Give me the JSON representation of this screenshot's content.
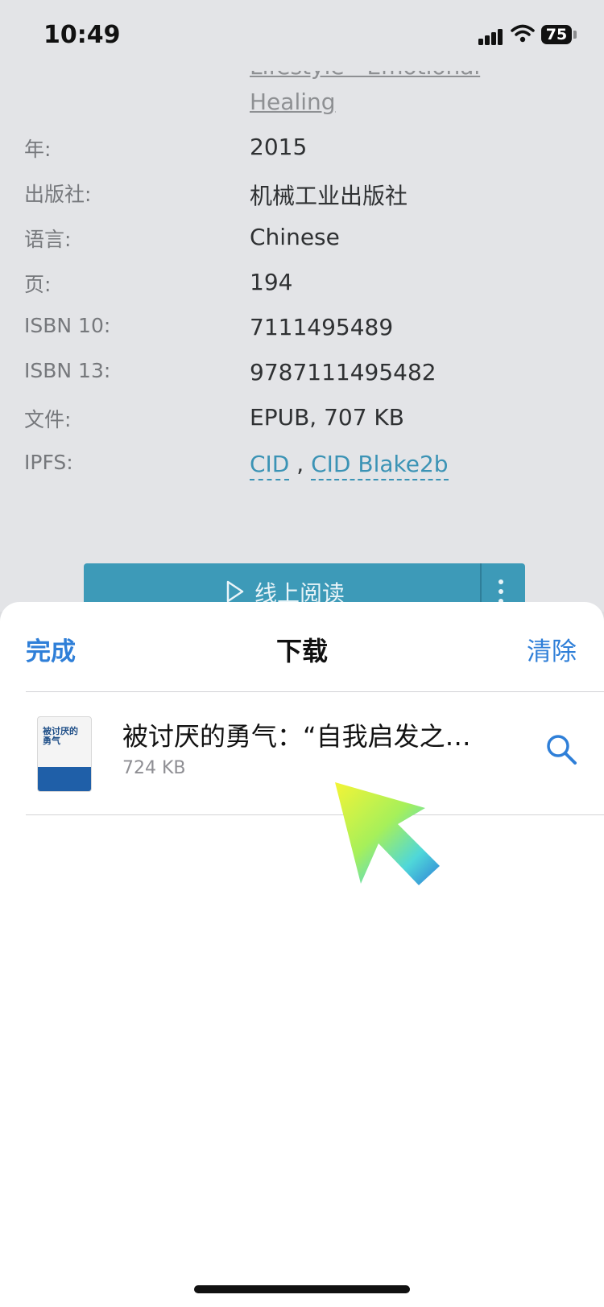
{
  "status_bar": {
    "time": "10:49",
    "battery": "75"
  },
  "details": {
    "category_partial_line1": "Lifestyle - Emotional",
    "category_partial_line2": "Healing",
    "rows": [
      {
        "label": "年:",
        "value": "2015"
      },
      {
        "label": "出版社:",
        "value": "机械工业出版社"
      },
      {
        "label": "语言:",
        "value": "Chinese"
      },
      {
        "label": "页:",
        "value": "194"
      },
      {
        "label": "ISBN 10:",
        "value": "7111495489"
      },
      {
        "label": "ISBN 13:",
        "value": "9787111495482"
      },
      {
        "label": "文件:",
        "value": "EPUB, 707 KB"
      }
    ],
    "ipfs": {
      "label": "IPFS:",
      "link1": "CID",
      "separator": ",",
      "link2": "CID Blake2b"
    }
  },
  "read_online_button": {
    "label": "线上阅读"
  },
  "downloads_sheet": {
    "done_label": "完成",
    "title": "下载",
    "clear_label": "清除",
    "items": [
      {
        "name": "被讨厌的勇气：“自我启发之…",
        "size": "724 KB",
        "cover_text": "被讨厌的勇气"
      }
    ]
  },
  "colors": {
    "accent": "#2f7fd8",
    "link": "#3b93b5",
    "button": "#3d9ab8"
  }
}
